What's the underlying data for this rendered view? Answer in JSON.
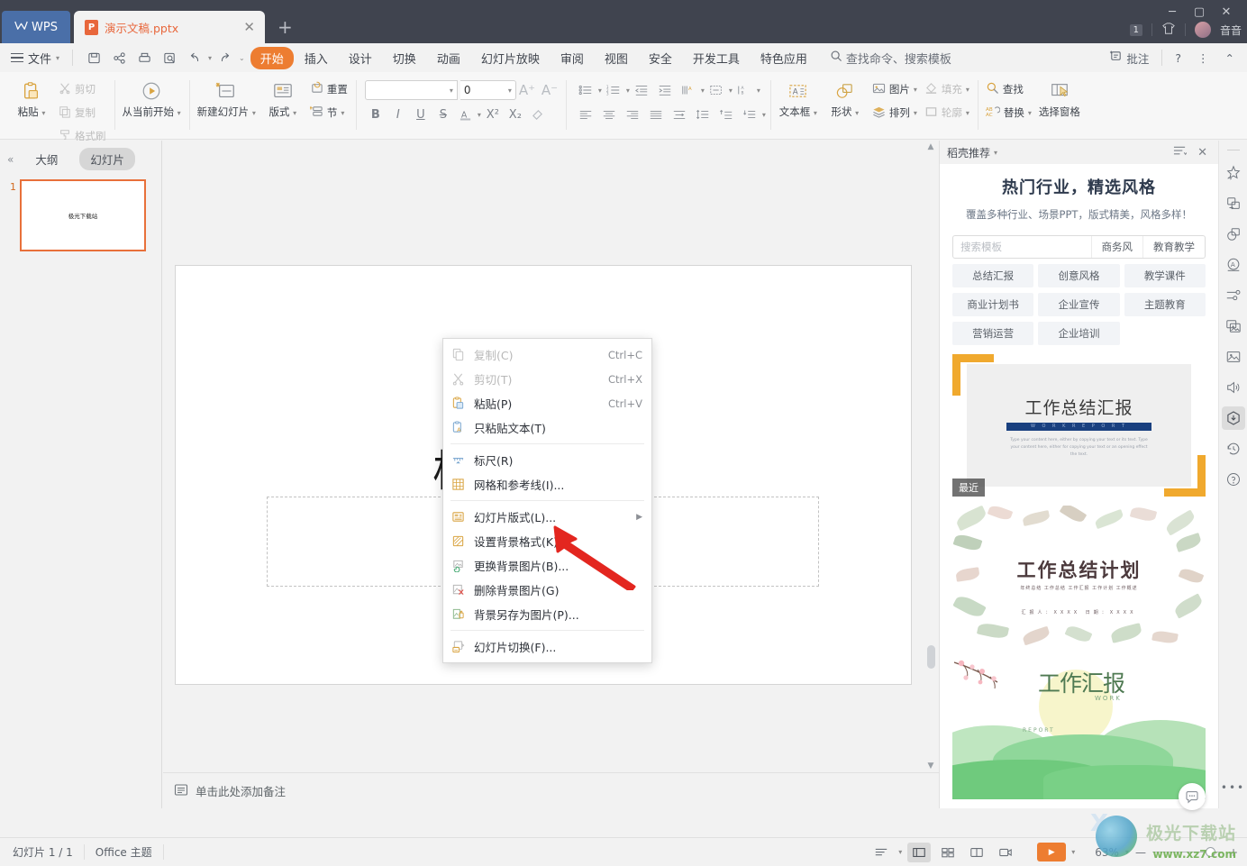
{
  "titlebar": {
    "app_name": "WPS",
    "tab": {
      "label": "演示文稿.pptx",
      "icon": "pptx-file-icon",
      "close": "✕"
    },
    "new_tab": "+",
    "window_controls": {
      "minimize": "─",
      "maximize": "▢",
      "close": "✕"
    },
    "doc_count_badge": "1",
    "user_name": "音音"
  },
  "menubar": {
    "file_label": "文件",
    "quick_access": [
      "save-icon",
      "share-icon",
      "print-icon",
      "print-preview-icon",
      "undo-icon",
      "redo-icon",
      "customize-icon"
    ],
    "tabs": [
      {
        "label": "开始",
        "active": true
      },
      {
        "label": "插入",
        "active": false
      },
      {
        "label": "设计",
        "active": false
      },
      {
        "label": "切换",
        "active": false
      },
      {
        "label": "动画",
        "active": false
      },
      {
        "label": "幻灯片放映",
        "active": false
      },
      {
        "label": "审阅",
        "active": false
      },
      {
        "label": "视图",
        "active": false
      },
      {
        "label": "安全",
        "active": false
      },
      {
        "label": "开发工具",
        "active": false
      },
      {
        "label": "特色应用",
        "active": false
      }
    ],
    "search_placeholder": "查找命令、搜索模板",
    "comment_label": "批注",
    "help_label": "?",
    "more_label": "⋮",
    "collapse_label": "⌃"
  },
  "ribbon": {
    "groups": [
      {
        "name": "clipboard",
        "big": {
          "label": "粘贴",
          "icon": "paste-icon",
          "dropdown": true
        },
        "small": [
          {
            "label": "剪切",
            "icon": "cut-icon",
            "disabled": true
          },
          {
            "label": "复制",
            "icon": "copy-icon",
            "disabled": true
          },
          {
            "label": "格式刷",
            "icon": "format-painter-icon",
            "disabled": true
          }
        ]
      },
      {
        "name": "slideshow",
        "big": {
          "label": "从当前开始",
          "icon": "play-circle-icon",
          "dropdown": true
        }
      },
      {
        "name": "slides",
        "big": {
          "label": "新建幻灯片",
          "icon": "new-slide-icon",
          "dropdown": true
        },
        "big2": {
          "label": "版式",
          "icon": "layout-icon",
          "dropdown": true
        },
        "small": [
          {
            "label": "重置",
            "icon": "reset-icon",
            "disabled": false
          },
          {
            "label": "节",
            "icon": "section-icon",
            "disabled": false,
            "dropdown": true
          }
        ]
      },
      {
        "name": "font",
        "font_family_value": "",
        "font_size_value": "0",
        "grow": "A⁺",
        "shrink": "A⁻",
        "buttons": [
          "bold-icon",
          "italic-icon",
          "underline-icon",
          "strikethrough-icon",
          "font-color-icon",
          "superscript-icon",
          "subscript-icon",
          "clear-format-icon"
        ]
      },
      {
        "name": "paragraph",
        "row1": [
          "bullets-icon",
          "numbering-icon",
          "decrease-indent-icon",
          "increase-indent-icon",
          "text-direction-icon",
          "align-text-icon",
          "columns-icon"
        ],
        "row2": [
          "align-left-icon",
          "align-center-icon",
          "align-right-icon",
          "justify-icon",
          "distribute-icon",
          "line-spacing-icon",
          "space-before-icon",
          "space-after-icon"
        ]
      },
      {
        "name": "drawing",
        "big": {
          "label": "文本框",
          "icon": "textbox-icon",
          "dropdown": true
        },
        "big2": {
          "label": "形状",
          "icon": "shapes-icon",
          "dropdown": true
        },
        "small": [
          {
            "label": "图片",
            "icon": "picture-icon",
            "dropdown": true,
            "disabled": false
          },
          {
            "label": "排列",
            "icon": "arrange-icon",
            "dropdown": true,
            "disabled": false
          },
          {
            "label": "填充",
            "icon": "fill-icon",
            "dropdown": true,
            "disabled": true
          },
          {
            "label": "轮廓",
            "icon": "outline-icon",
            "dropdown": true,
            "disabled": true
          }
        ]
      },
      {
        "name": "editing",
        "small": [
          {
            "label": "查找",
            "icon": "find-icon",
            "disabled": false
          },
          {
            "label": "替换",
            "icon": "replace-icon",
            "dropdown": true,
            "disabled": false
          }
        ],
        "big": {
          "label": "选择窗格",
          "icon": "selection-pane-icon"
        }
      }
    ]
  },
  "left_panel": {
    "collapse_icon": "«",
    "tabs": [
      {
        "label": "大纲",
        "active": false
      },
      {
        "label": "幻灯片",
        "active": true
      }
    ],
    "slides": [
      {
        "number": "1",
        "thumb_text": "极光下载站",
        "selected": true
      }
    ]
  },
  "canvas": {
    "slide_title": "极光下载站",
    "notes_placeholder": "单击此处添加备注",
    "notes_icon": "notes-icon"
  },
  "context_menu": {
    "items": [
      {
        "label": "复制(C)",
        "shortcut": "Ctrl+C",
        "icon": "copy-icon",
        "disabled": true,
        "submenu": false
      },
      {
        "label": "剪切(T)",
        "shortcut": "Ctrl+X",
        "icon": "cut-icon",
        "disabled": true,
        "submenu": false
      },
      {
        "label": "粘贴(P)",
        "shortcut": "Ctrl+V",
        "icon": "paste-icon",
        "disabled": false,
        "submenu": false
      },
      {
        "label": "只粘贴文本(T)",
        "shortcut": "",
        "icon": "paste-text-icon",
        "disabled": false,
        "submenu": false
      },
      {
        "sep": true
      },
      {
        "label": "标尺(R)",
        "shortcut": "",
        "icon": "ruler-icon",
        "disabled": false,
        "submenu": false
      },
      {
        "label": "网格和参考线(I)...",
        "shortcut": "",
        "icon": "grid-guides-icon",
        "disabled": false,
        "submenu": false
      },
      {
        "sep": true
      },
      {
        "label": "幻灯片版式(L)...",
        "shortcut": "",
        "icon": "slide-layout-icon",
        "disabled": false,
        "submenu": true
      },
      {
        "label": "设置背景格式(K)...",
        "shortcut": "",
        "icon": "format-background-icon",
        "disabled": false,
        "submenu": false
      },
      {
        "label": "更换背景图片(B)...",
        "shortcut": "",
        "icon": "change-background-icon",
        "disabled": false,
        "submenu": false
      },
      {
        "label": "删除背景图片(G)",
        "shortcut": "",
        "icon": "delete-background-icon",
        "disabled": false,
        "submenu": false
      },
      {
        "label": "背景另存为图片(P)...",
        "shortcut": "",
        "icon": "save-background-icon",
        "disabled": false,
        "submenu": false
      },
      {
        "sep": true
      },
      {
        "label": "幻灯片切换(F)...",
        "shortcut": "",
        "icon": "slide-transition-icon",
        "disabled": false,
        "submenu": false
      }
    ],
    "annotation": {
      "type": "red-arrow",
      "points_to": "设置背景格式(K)...",
      "color": "#e3261f"
    }
  },
  "right_panel": {
    "header_title": "稻壳推荐",
    "header_caret": "▾",
    "menu_icon": "list-menu-icon",
    "close_icon": "✕",
    "title": "热门行业，精选风格",
    "subtitle": "覆盖多种行业、场景PPT，版式精美，风格多样！",
    "search_placeholder": "搜索模板",
    "search_chips": [
      "商务风",
      "教育教学"
    ],
    "tag_rows": [
      [
        "总结汇报",
        "创意风格",
        "教学课件"
      ],
      [
        "商业计划书",
        "企业宣传",
        "主题教育"
      ],
      [
        "营销运营",
        "企业培训",
        ""
      ]
    ],
    "templates": [
      {
        "name": "work-summary-report",
        "title": "工作总结汇报",
        "sub_en": "W O R K   R E P O R T",
        "body": "Type your content here, either by copying your text or its text. Type your content here, either for copying your text or an opening effect the text.",
        "badge": "最近",
        "style": "blue-orange"
      },
      {
        "name": "work-summary-plan",
        "title": "工作总结计划",
        "sub": "年终总结 工作总结 工作汇报 工作计划 工作概述",
        "meta": "汇报人：XXXX        日期：XXXX",
        "style": "pink-floral"
      },
      {
        "name": "work-report-spring",
        "title": "工作汇报",
        "sub_en_1": "WORK",
        "sub_en_2": "REPORT",
        "style": "green-spring"
      }
    ]
  },
  "mini_rail": {
    "icons": [
      "effects-icon",
      "duplicate-icon",
      "shapes-icon",
      "text-art-icon",
      "adjust-icon",
      "album-icon",
      "image-icon",
      "audio-icon",
      "docer-icon",
      "history-icon",
      "help-icon",
      "more-icon"
    ],
    "selected": "docer-icon"
  },
  "statusbar": {
    "slide_count": "幻灯片 1 / 1",
    "theme": "Office 主题",
    "view_icons": [
      "outline-view-icon",
      "normal-view-icon",
      "slide-sorter-icon",
      "reading-view-icon",
      "presenter-view-icon"
    ],
    "selected_view": "normal-view-icon",
    "play_label": "▶",
    "zoom_level": "63%",
    "zoom_minus": "—",
    "zoom_plus": "+"
  },
  "watermark": {
    "brand": "极光下载站",
    "url": "www.xz7.com"
  },
  "colors": {
    "accent_orange": "#ed7d31",
    "titlebar": "#40444f",
    "tab_text": "#e8673c",
    "annotation_red": "#e3261f",
    "panel_bg": "#f2f2f2"
  }
}
